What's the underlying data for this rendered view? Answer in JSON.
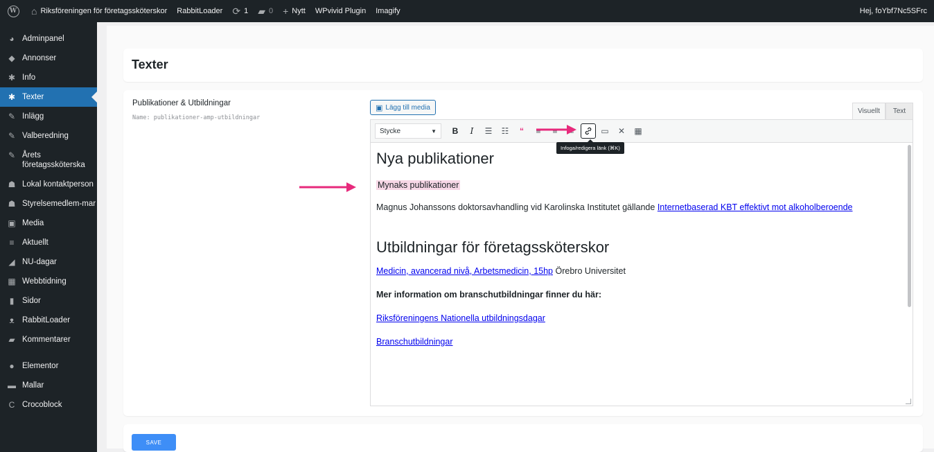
{
  "adminbar": {
    "site_name": "Riksföreningen för företagssköterskor",
    "rabbitloader": "RabbitLoader",
    "updates_count": "1",
    "comments_count": "0",
    "new_label": "Nytt",
    "wpvivid": "WPvivid Plugin",
    "imagify": "Imagify",
    "greeting": "Hej, foYbf7Nc5SFrc"
  },
  "sidebar": {
    "items": [
      {
        "label": "Adminpanel",
        "icon": "dashboard-icon",
        "glyph": "◕"
      },
      {
        "label": "Annonser",
        "icon": "tag-icon",
        "glyph": "◆"
      },
      {
        "label": "Info",
        "icon": "gear-icon",
        "glyph": "✱"
      },
      {
        "label": "Texter",
        "icon": "gear-icon",
        "glyph": "✱"
      },
      {
        "label": "Inlägg",
        "icon": "pin-icon",
        "glyph": "✎"
      },
      {
        "label": "Valberedning",
        "icon": "pin-icon",
        "glyph": "✎"
      },
      {
        "label": "Årets företagssköterska",
        "icon": "pin-icon",
        "glyph": "✎"
      },
      {
        "label": "Lokal kontaktperson",
        "icon": "user-icon",
        "glyph": "☗"
      },
      {
        "label": "Styrelsemedlem-mar",
        "icon": "user-icon",
        "glyph": "☗"
      },
      {
        "label": "Media",
        "icon": "media-icon",
        "glyph": "▣"
      },
      {
        "label": "Aktuellt",
        "icon": "list-icon",
        "glyph": "≡"
      },
      {
        "label": "NU-dagar",
        "icon": "megaphone-icon",
        "glyph": "◢"
      },
      {
        "label": "Webbtidning",
        "icon": "grid-icon",
        "glyph": "▦"
      },
      {
        "label": "Sidor",
        "icon": "page-icon",
        "glyph": "▮"
      },
      {
        "label": "RabbitLoader",
        "icon": "rabbit-icon",
        "glyph": "ᴥ"
      },
      {
        "label": "Kommentarer",
        "icon": "comment-icon",
        "glyph": "▰"
      },
      {
        "label": "Elementor",
        "icon": "elementor-icon",
        "glyph": "●"
      },
      {
        "label": "Mallar",
        "icon": "folder-icon",
        "glyph": "▬"
      },
      {
        "label": "Crocoblock",
        "icon": "crocoblock-icon",
        "glyph": "C"
      }
    ]
  },
  "page": {
    "title": "Texter"
  },
  "field": {
    "label": "Publikationer & Utbildningar",
    "name": "Name: publikationer-amp-utbildningar"
  },
  "editor": {
    "add_media_label": "Lägg till media",
    "tab_visual": "Visuellt",
    "tab_text": "Text",
    "format_value": "Stycke",
    "tooltip": "Infoga/redigera länk (⌘K)",
    "heading1": "Nya publikationer",
    "highlighted": "Mynaks publikationer",
    "para1_text": "Magnus Johanssons doktorsavhandling vid Karolinska Institutet gällande",
    "para1_link": "Internetbaserad KBT effektivt mot alkoholberoende",
    "heading2": "Utbildningar för företagssköterskor",
    "para2_link": "Medicin, avancerad nivå, Arbetsmedicin, 15hp",
    "para2_text": "Örebro Universitet",
    "para3_bold": "Mer information om branschutbildningar finner du här:",
    "link3": "Riksföreningens Nationella utbildningsdagar",
    "link4": "Branschutbildningar"
  },
  "save_label": "SAVE",
  "colors": {
    "accent": "#2271b1",
    "arrow": "#e72a7c",
    "save": "#3e8ef7"
  }
}
